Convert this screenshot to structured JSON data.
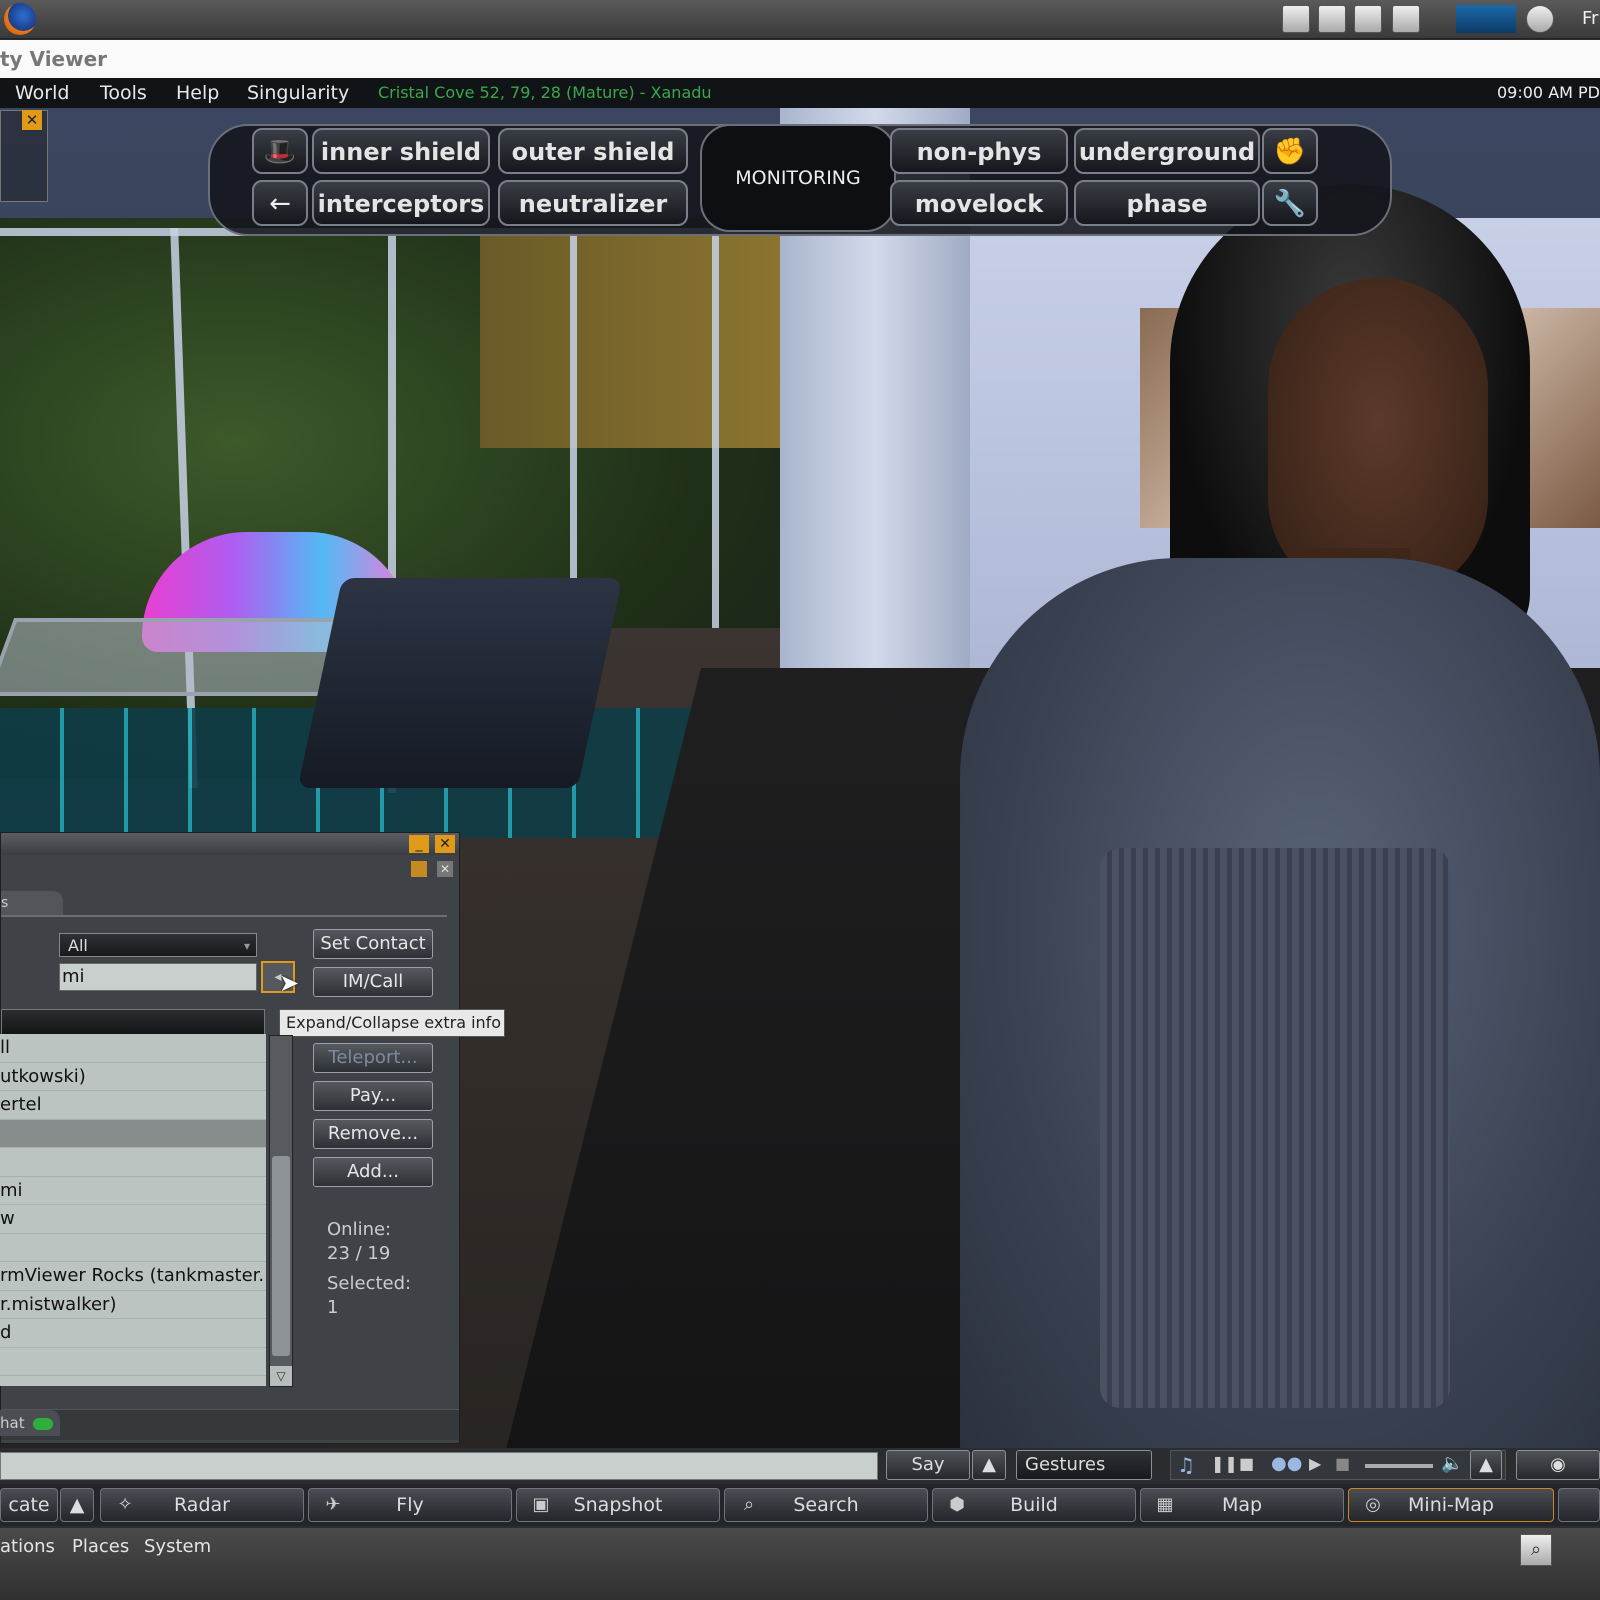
{
  "window": {
    "title": "ty Viewer"
  },
  "os_top": {
    "clock": "Fr"
  },
  "menubar": {
    "items": [
      "World",
      "Tools",
      "Help",
      "Singularity"
    ],
    "location": "Cristal Cove 52, 79, 28 (Mature) - Xanadu",
    "time": "09:00 AM PD"
  },
  "hud": {
    "buttons": [
      "inner shield",
      "outer shield",
      "interceptors",
      "neutralizer",
      "non-phys",
      "underground",
      "movelock",
      "phase"
    ],
    "center": "MONITORING"
  },
  "friends": {
    "tab_label": "s",
    "filter_value": "All",
    "search_value": "mi",
    "tooltip": "Expand/Collapse extra info",
    "buttons": {
      "set_contact": "Set Contact",
      "im_call": "IM/Call",
      "teleport": "Teleport...",
      "pay": "Pay...",
      "remove": "Remove...",
      "add": "Add..."
    },
    "rows": [
      "ll",
      "utkowski)",
      "ertel",
      "",
      "",
      "mi",
      "w",
      "",
      "rmViewer Rocks (tankmaster...",
      "r.mistwalker)",
      "d",
      "",
      ""
    ],
    "selected_index": 3,
    "online_label": "Online:",
    "online_value": "23 / 19",
    "selected_label": "Selected:",
    "selected_value": "1",
    "chat_tab": "hat"
  },
  "chatbar": {
    "say": "Say",
    "gestures": "Gestures"
  },
  "toolbar": {
    "locate": "cate",
    "radar": "Radar",
    "fly": "Fly",
    "snapshot": "Snapshot",
    "search": "Search",
    "build": "Build",
    "map": "Map",
    "minimap": "Mini-Map"
  },
  "os_bottom": {
    "items": [
      "ations",
      "Places",
      "System"
    ]
  },
  "colors": {
    "location": "#3aa84a",
    "accent": "#e09a1a"
  }
}
